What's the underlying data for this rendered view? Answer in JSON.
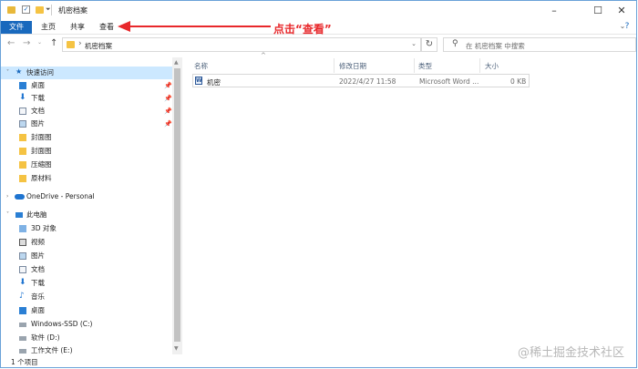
{
  "window": {
    "title": "机密档案"
  },
  "ribbon": {
    "tabs": [
      {
        "label": "文件"
      },
      {
        "label": "主页"
      },
      {
        "label": "共享"
      },
      {
        "label": "查看"
      }
    ],
    "annotation_text": "点击“查看”"
  },
  "address": {
    "path": "机密档案"
  },
  "search": {
    "placeholder": "在 机密档案 中搜索"
  },
  "sidebar": {
    "quick_access": "快速访问",
    "quick_items": [
      {
        "label": "桌面",
        "icon": "desktop-icon",
        "pinned": true
      },
      {
        "label": "下载",
        "icon": "download-icon",
        "pinned": true
      },
      {
        "label": "文档",
        "icon": "document-icon",
        "pinned": true
      },
      {
        "label": "图片",
        "icon": "picture-icon",
        "pinned": true
      },
      {
        "label": "封面图",
        "icon": "folder-icon",
        "pinned": false
      },
      {
        "label": "封面图",
        "icon": "folder-icon",
        "pinned": false
      },
      {
        "label": "压缩图",
        "icon": "folder-icon",
        "pinned": false
      },
      {
        "label": "原材料",
        "icon": "folder-icon",
        "pinned": false
      }
    ],
    "onedrive": "OneDrive - Personal",
    "this_pc": "此电脑",
    "pc_items": [
      {
        "label": "3D 对象",
        "icon": "3d-objects-icon"
      },
      {
        "label": "视频",
        "icon": "video-icon"
      },
      {
        "label": "图片",
        "icon": "picture-icon"
      },
      {
        "label": "文档",
        "icon": "document-icon"
      },
      {
        "label": "下载",
        "icon": "download-icon"
      },
      {
        "label": "音乐",
        "icon": "music-icon"
      },
      {
        "label": "桌面",
        "icon": "desktop-icon"
      },
      {
        "label": "Windows-SSD (C:)",
        "icon": "drive-icon"
      },
      {
        "label": "软件 (D:)",
        "icon": "drive-icon"
      },
      {
        "label": "工作文件 (E:)",
        "icon": "drive-icon"
      }
    ]
  },
  "columns": {
    "name": "名称",
    "modified": "修改日期",
    "type": "类型",
    "size": "大小"
  },
  "files": [
    {
      "name": "机密",
      "modified": "2022/4/27 11:58",
      "type": "Microsoft Word ...",
      "size": "0 KB"
    }
  ],
  "status": {
    "count": "1 个项目"
  },
  "watermark": "@稀土掘金技术社区",
  "colors": {
    "accent": "#1969bd",
    "annotation": "#e8282b",
    "selected": "#cce8ff"
  }
}
